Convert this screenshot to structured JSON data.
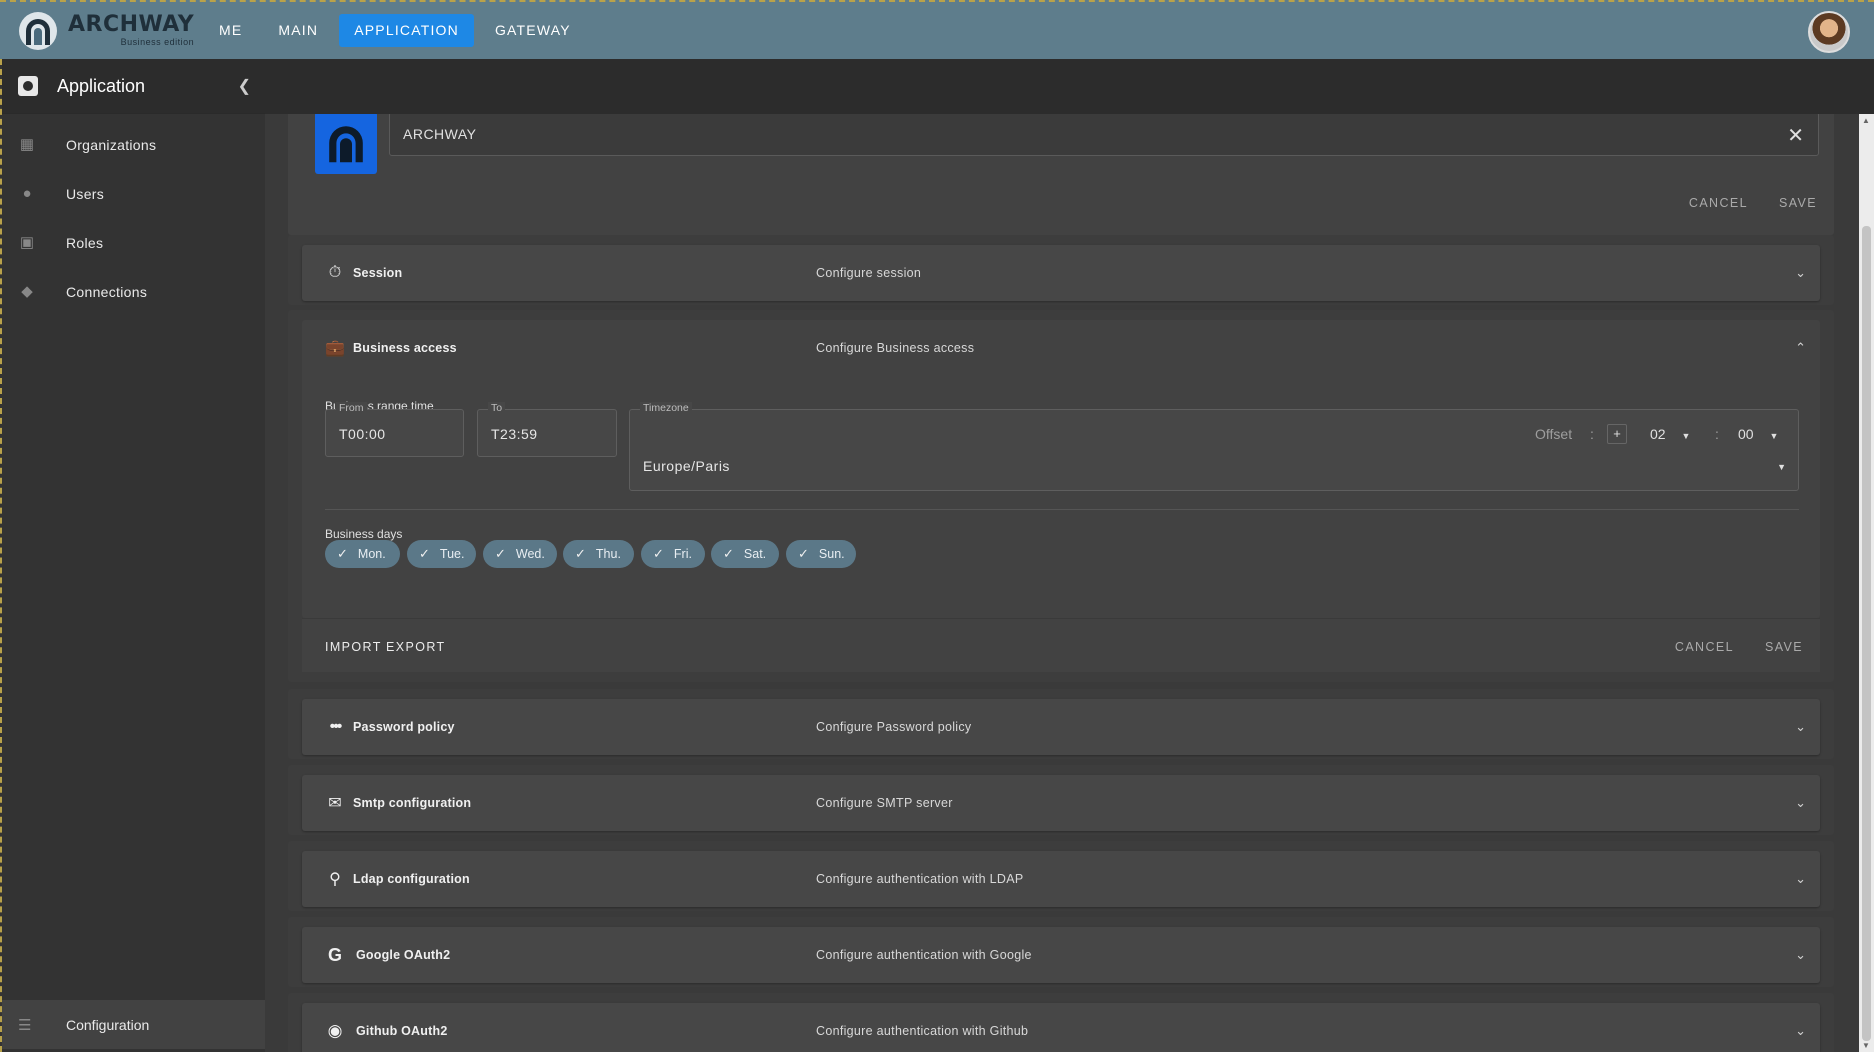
{
  "topbar": {
    "logo_title": "ARCHWAY",
    "logo_subtitle": "Business edition",
    "nav": [
      "ME",
      "MAIN",
      "APPLICATION",
      "GATEWAY"
    ],
    "active_nav": "APPLICATION",
    "accent_color": "#1e88e5",
    "bar_color": "#5e7d8c"
  },
  "sidebar": {
    "title": "Application",
    "items": [
      {
        "label": "Organizations",
        "icon": "building-icon"
      },
      {
        "label": "Users",
        "icon": "users-gear-icon"
      },
      {
        "label": "Roles",
        "icon": "badge-icon"
      },
      {
        "label": "Connections",
        "icon": "shield-lock-icon"
      }
    ],
    "bottom_item": {
      "label": "Configuration",
      "icon": "sliders-icon"
    }
  },
  "app_card": {
    "name_value": "ARCHWAY",
    "cancel": "CANCEL",
    "save": "SAVE"
  },
  "panels": {
    "session": {
      "title": "Session",
      "desc": "Configure session"
    },
    "business_access": {
      "title": "Business access",
      "desc": "Configure Business access",
      "range_label": "Business range time",
      "from_legend": "From",
      "from_value": "T00:00",
      "to_legend": "To",
      "to_value": "T23:59",
      "timezone_legend": "Timezone",
      "timezone_value": "Europe/Paris",
      "offset_label": "Offset",
      "offset_colon": ":",
      "offset_sign": "+",
      "offset_hours": "02",
      "offset_minutes": "00",
      "days_label": "Business days",
      "days": [
        "Mon.",
        "Tue.",
        "Wed.",
        "Thu.",
        "Fri.",
        "Sat.",
        "Sun."
      ],
      "import": "IMPORT",
      "export": "EXPORT",
      "cancel": "CANCEL",
      "save": "SAVE"
    },
    "password_policy": {
      "title": "Password policy",
      "desc": "Configure Password policy"
    },
    "smtp": {
      "title": "Smtp configuration",
      "desc": "Configure SMTP server"
    },
    "ldap": {
      "title": "Ldap configuration",
      "desc": "Configure authentication with LDAP"
    },
    "google": {
      "title": "Google OAuth2",
      "desc": "Configure authentication with Google"
    },
    "github": {
      "title": "Github OAuth2",
      "desc": "Configure authentication with Github"
    }
  }
}
